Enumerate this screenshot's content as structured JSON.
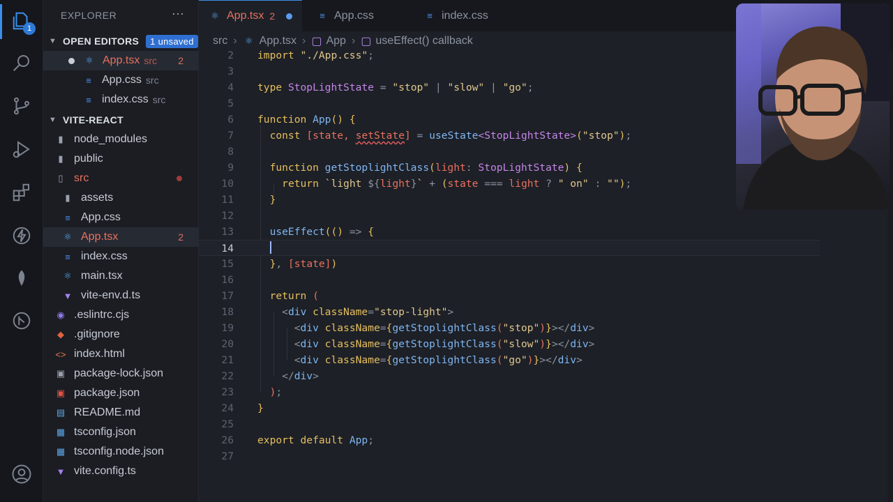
{
  "activity": {
    "explorer_badge": "1"
  },
  "explorer": {
    "title": "EXPLORER",
    "more": "⋯",
    "open_editors": {
      "label": "OPEN EDITORS",
      "unsaved": "1 unsaved",
      "items": [
        {
          "name": "App.tsx",
          "desc": "src",
          "count": "2"
        },
        {
          "name": "App.css",
          "desc": "src"
        },
        {
          "name": "index.css",
          "desc": "src"
        }
      ]
    },
    "project": {
      "label": "VITE-REACT",
      "items": [
        {
          "name": "node_modules"
        },
        {
          "name": "public"
        },
        {
          "name": "src"
        },
        {
          "name": "assets"
        },
        {
          "name": "App.css"
        },
        {
          "name": "App.tsx",
          "count": "2"
        },
        {
          "name": "index.css"
        },
        {
          "name": "main.tsx"
        },
        {
          "name": "vite-env.d.ts"
        },
        {
          "name": ".eslintrc.cjs"
        },
        {
          "name": ".gitignore"
        },
        {
          "name": "index.html"
        },
        {
          "name": "package-lock.json"
        },
        {
          "name": "package.json"
        },
        {
          "name": "README.md"
        },
        {
          "name": "tsconfig.json"
        },
        {
          "name": "tsconfig.node.json"
        },
        {
          "name": "vite.config.ts"
        }
      ]
    }
  },
  "tabs": [
    {
      "label": "App.tsx",
      "count": "2"
    },
    {
      "label": "App.css"
    },
    {
      "label": "index.css"
    }
  ],
  "breadcrumb": [
    "src",
    "App.tsx",
    "App",
    "useEffect() callback"
  ],
  "editor": {
    "line_numbers": [
      "2",
      "3",
      "4",
      "5",
      "6",
      "7",
      "8",
      "9",
      "10",
      "11",
      "12",
      "13",
      "14",
      "15",
      "16",
      "17",
      "18",
      "19",
      "20",
      "21",
      "22",
      "23",
      "24",
      "25",
      "26",
      "27"
    ],
    "current_line": "14"
  },
  "colors": {
    "accent": "#3b8eea",
    "error": "#e8715f",
    "keyword": "#e6bf5e",
    "type": "#c486e8",
    "function": "#7fb6f0"
  }
}
